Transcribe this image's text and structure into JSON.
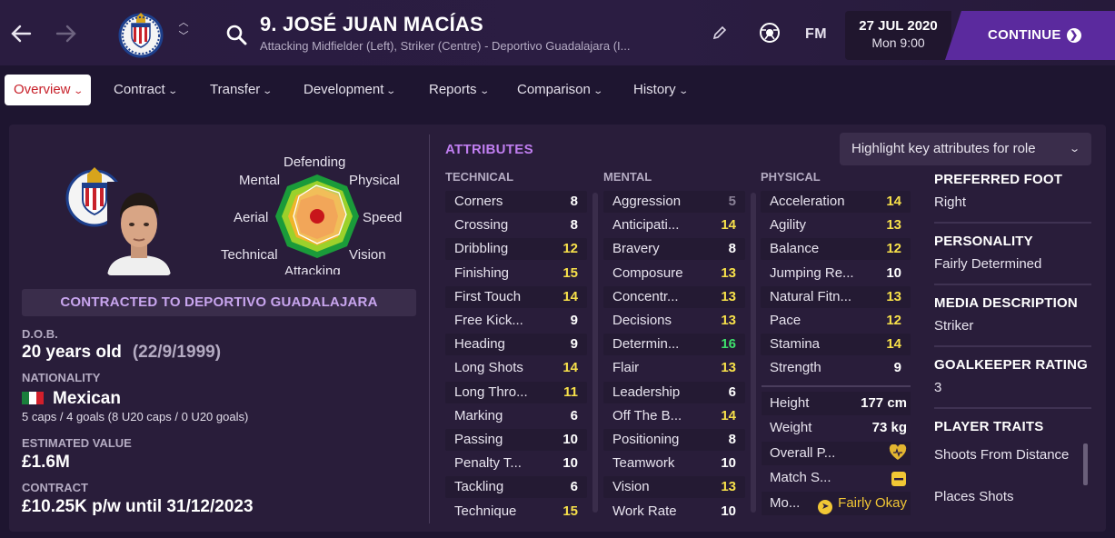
{
  "header": {
    "player_name": "9. JOSÉ JUAN MACÍAS",
    "player_subtitle": "Attacking Midfielder (Left), Striker (Centre) - Deportivo Guadalajara (I...",
    "date": "27 JUL 2020",
    "time": "Mon 9:00",
    "fm_label": "FM",
    "continue_label": "CONTINUE"
  },
  "tabs": [
    {
      "label": "Overview",
      "active": true
    },
    {
      "label": "Contract"
    },
    {
      "label": "Transfer"
    },
    {
      "label": "Development"
    },
    {
      "label": "Reports"
    },
    {
      "label": "Comparison"
    },
    {
      "label": "History"
    }
  ],
  "profile": {
    "radar_labels": {
      "top": "Defending",
      "top_right": "Physical",
      "right": "Speed",
      "bottom_right": "Vision",
      "bottom": "Attacking",
      "bottom_left": "Technical",
      "left": "Aerial",
      "top_left": "Mental"
    },
    "contracted_to": "CONTRACTED TO DEPORTIVO GUADALAJARA",
    "dob_label": "D.O.B.",
    "age": "20 years old",
    "dob": "(22/9/1999)",
    "nationality_label": "NATIONALITY",
    "nationality": "Mexican",
    "caps": "5 caps / 4 goals (8 U20 caps / 0 U20 goals)",
    "value_label": "ESTIMATED VALUE",
    "value": "£1.6M",
    "contract_label": "CONTRACT",
    "contract": "£10.25K p/w until 31/12/2023"
  },
  "attributes": {
    "title": "ATTRIBUTES",
    "highlight_label": "Highlight key attributes for role",
    "technical_head": "TECHNICAL",
    "mental_head": "MENTAL",
    "physical_head": "PHYSICAL",
    "technical": [
      {
        "name": "Corners",
        "value": "8"
      },
      {
        "name": "Crossing",
        "value": "8"
      },
      {
        "name": "Dribbling",
        "value": "12"
      },
      {
        "name": "Finishing",
        "value": "15"
      },
      {
        "name": "First Touch",
        "value": "14"
      },
      {
        "name": "Free Kick...",
        "value": "9"
      },
      {
        "name": "Heading",
        "value": "9"
      },
      {
        "name": "Long Shots",
        "value": "14"
      },
      {
        "name": "Long Thro...",
        "value": "11"
      },
      {
        "name": "Marking",
        "value": "6"
      },
      {
        "name": "Passing",
        "value": "10"
      },
      {
        "name": "Penalty T...",
        "value": "10"
      },
      {
        "name": "Tackling",
        "value": "6"
      },
      {
        "name": "Technique",
        "value": "15"
      }
    ],
    "mental": [
      {
        "name": "Aggression",
        "value": "5"
      },
      {
        "name": "Anticipati...",
        "value": "14"
      },
      {
        "name": "Bravery",
        "value": "8"
      },
      {
        "name": "Composure",
        "value": "13"
      },
      {
        "name": "Concentr...",
        "value": "13"
      },
      {
        "name": "Decisions",
        "value": "13"
      },
      {
        "name": "Determin...",
        "value": "16"
      },
      {
        "name": "Flair",
        "value": "13"
      },
      {
        "name": "Leadership",
        "value": "6"
      },
      {
        "name": "Off The B...",
        "value": "14"
      },
      {
        "name": "Positioning",
        "value": "8"
      },
      {
        "name": "Teamwork",
        "value": "10"
      },
      {
        "name": "Vision",
        "value": "13"
      },
      {
        "name": "Work Rate",
        "value": "10"
      }
    ],
    "physical": [
      {
        "name": "Acceleration",
        "value": "14"
      },
      {
        "name": "Agility",
        "value": "13"
      },
      {
        "name": "Balance",
        "value": "12"
      },
      {
        "name": "Jumping Re...",
        "value": "10"
      },
      {
        "name": "Natural Fitn...",
        "value": "13"
      },
      {
        "name": "Pace",
        "value": "12"
      },
      {
        "name": "Stamina",
        "value": "14"
      },
      {
        "name": "Strength",
        "value": "9"
      }
    ],
    "info": {
      "height_label": "Height",
      "height": "177 cm",
      "weight_label": "Weight",
      "weight": "73 kg",
      "overall_label": "Overall P...",
      "match_label": "Match S...",
      "morale_label": "Mo...",
      "morale": "Fairly Okay"
    }
  },
  "side": {
    "foot_h": "PREFERRED FOOT",
    "foot": "Right",
    "personality_h": "PERSONALITY",
    "personality": "Fairly Determined",
    "media_h": "MEDIA DESCRIPTION",
    "media": "Striker",
    "gk_h": "GOALKEEPER RATING",
    "gk": "3",
    "traits_h": "PLAYER TRAITS",
    "traits": [
      "Shoots From Distance",
      "Places Shots"
    ]
  },
  "colors": {
    "accent": "#5b2a9e",
    "attr_title": "#c07ef0",
    "yellow": "#f7e04a",
    "green": "#3ee06b",
    "active_tab_text": "#c8222b"
  }
}
